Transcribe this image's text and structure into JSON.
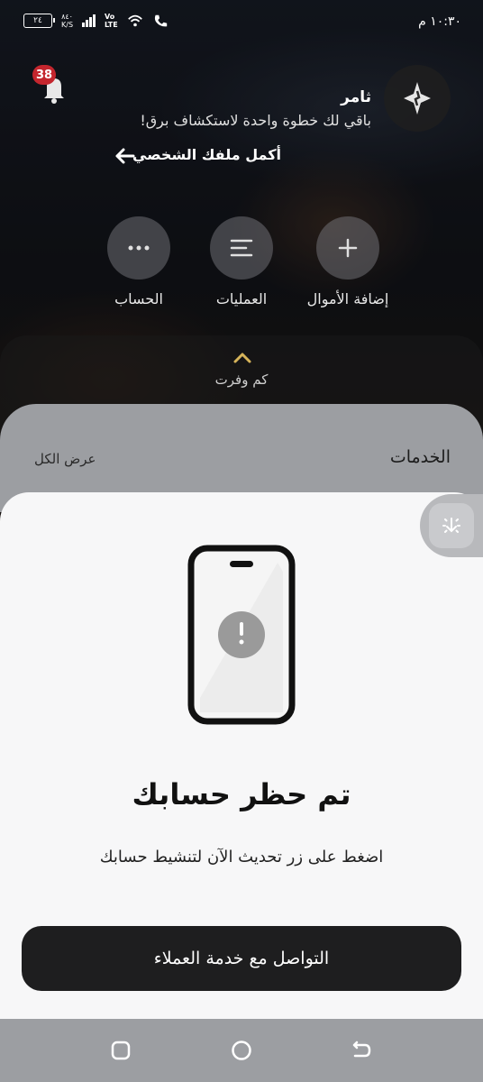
{
  "status_bar": {
    "time": "١٠:٣٠ م",
    "battery": "٢٤",
    "speed_value": "٨٤٠",
    "speed_unit": "K/S",
    "volte_top": "Vo",
    "volte_bottom": "LTE"
  },
  "header": {
    "notification_count": "38",
    "user_name": "ثامر",
    "tagline": "باقي لك خطوة واحدة لاستكشاف برق!",
    "complete_profile_label": "أكمل ملفك الشخصي"
  },
  "quick_actions": [
    {
      "label": "إضافة الأموال",
      "icon": "plus-icon"
    },
    {
      "label": "العمليات",
      "icon": "list-icon"
    },
    {
      "label": "الحساب",
      "icon": "more-icon"
    }
  ],
  "savings": {
    "label": "كم وفرت"
  },
  "services": {
    "title": "الخدمات",
    "view_all": "عرض الكل"
  },
  "sheet": {
    "title": "تم حظر حسابك",
    "message": "اضغط على زر تحديث الآن لتنشيط حسابك",
    "cta_label": "التواصل مع خدمة العملاء"
  },
  "colors": {
    "badge": "#c4262e",
    "sheet_bg": "#f7f7f8",
    "cta_bg": "#1e1e1f",
    "warning_circle": "#9a9a9a"
  }
}
